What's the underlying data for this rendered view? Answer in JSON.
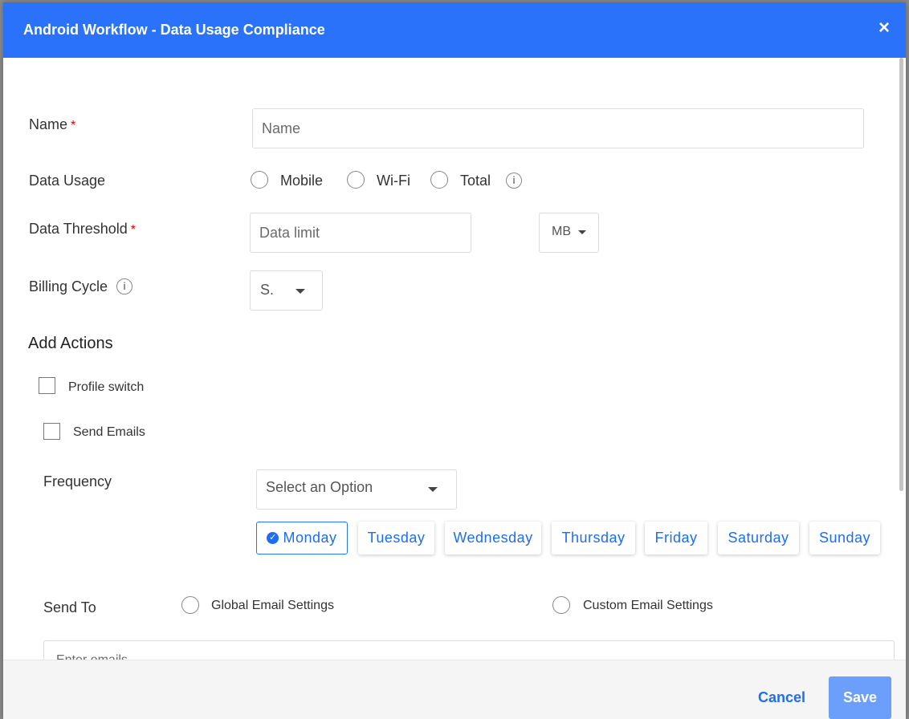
{
  "modal": {
    "title": "Android Workflow - Data Usage Compliance",
    "close": "×"
  },
  "form": {
    "name_label": "Name",
    "required_mark": "*",
    "name_placeholder": "Name",
    "data_usage_label": "Data Usage",
    "data_usage_options": [
      "Mobile",
      "Wi-Fi",
      "Total"
    ],
    "data_threshold_label": "Data Threshold",
    "data_limit_placeholder": "Data limit",
    "unit": "MB",
    "billing_cycle_label": "Billing Cycle",
    "billing_cycle_value": "S.",
    "add_actions_label": "Add Actions",
    "profile_switch_label": "Profile switch",
    "send_emails_label": "Send Emails",
    "frequency_label": "Frequency",
    "frequency_placeholder": "Select an Option",
    "days": [
      "Monday",
      "Tuesday",
      "Wednesday",
      "Thursday",
      "Friday",
      "Saturday",
      "Sunday"
    ],
    "selected_day": "Monday",
    "send_to_label": "Send To",
    "send_to_options": [
      "Global Email Settings",
      "Custom Email Settings"
    ],
    "emails_placeholder": "Enter emails"
  },
  "footer": {
    "cancel": "Cancel",
    "save": "Save"
  },
  "colors": {
    "header": "#2b72fb",
    "accent": "#1d6df5",
    "save_button": "#6c9efc",
    "required": "#e00000"
  }
}
